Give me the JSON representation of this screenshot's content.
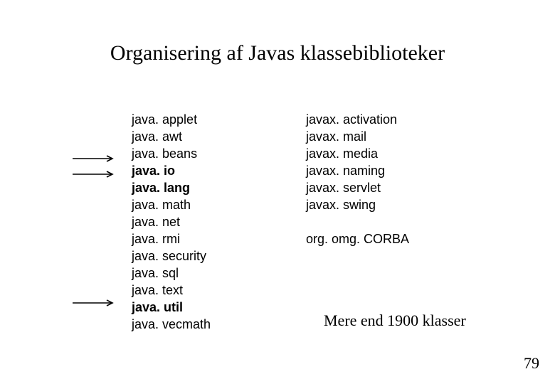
{
  "title": "Organisering af Javas klassebiblioteker",
  "left_packages": [
    {
      "name": "java. applet",
      "bold": false
    },
    {
      "name": "java. awt",
      "bold": false
    },
    {
      "name": "java. beans",
      "bold": false
    },
    {
      "name": "java. io",
      "bold": true
    },
    {
      "name": "java. lang",
      "bold": true
    },
    {
      "name": "java. math",
      "bold": false
    },
    {
      "name": "java. net",
      "bold": false
    },
    {
      "name": "java. rmi",
      "bold": false
    },
    {
      "name": "java. security",
      "bold": false
    },
    {
      "name": "java. sql",
      "bold": false
    },
    {
      "name": "java. text",
      "bold": false
    },
    {
      "name": "java. util",
      "bold": true
    },
    {
      "name": "java. vecmath",
      "bold": false
    }
  ],
  "right_packages_top": [
    "javax. activation",
    "javax. mail",
    "javax. media",
    "javax. naming",
    "javax. servlet",
    "javax. swing"
  ],
  "right_packages_bottom": [
    "org. omg. CORBA"
  ],
  "footer_note": "Mere end 1900 klasser",
  "page_number": "79",
  "arrow_count": 3
}
